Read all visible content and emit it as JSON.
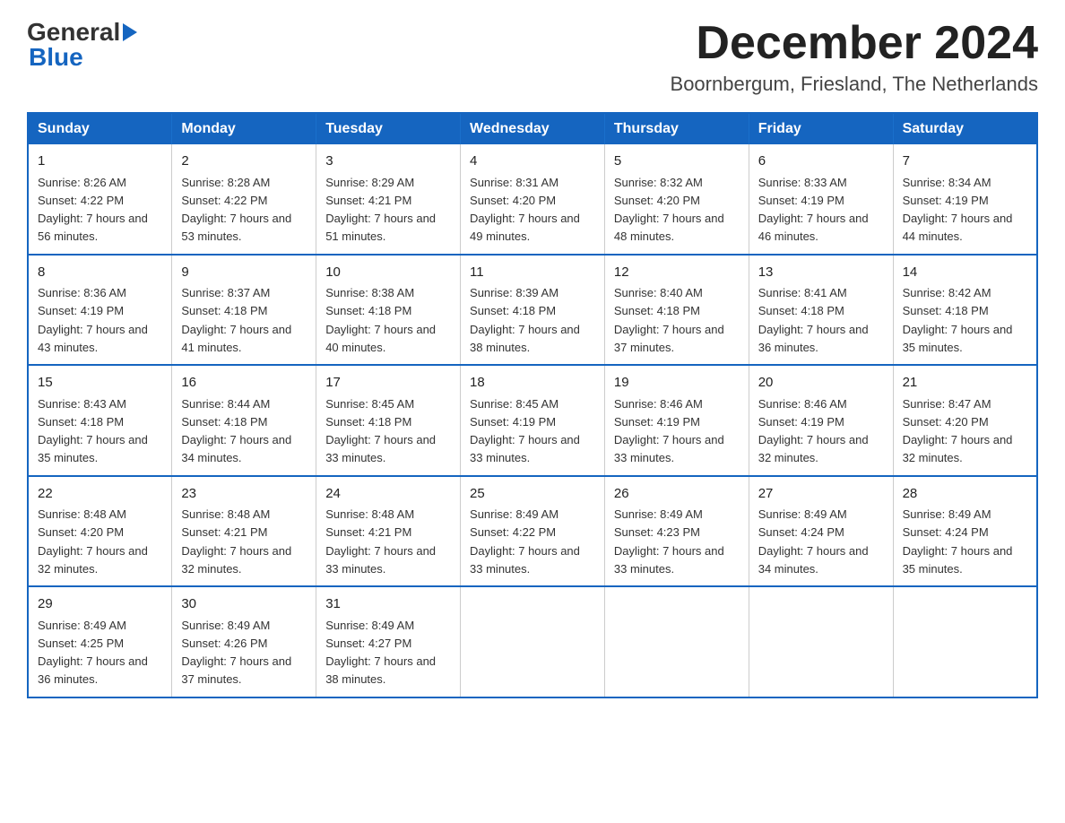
{
  "header": {
    "logo_general": "General",
    "logo_blue": "Blue",
    "month_title": "December 2024",
    "subtitle": "Boornbergum, Friesland, The Netherlands"
  },
  "weekdays": [
    "Sunday",
    "Monday",
    "Tuesday",
    "Wednesday",
    "Thursday",
    "Friday",
    "Saturday"
  ],
  "weeks": [
    [
      {
        "day": "1",
        "sunrise": "8:26 AM",
        "sunset": "4:22 PM",
        "daylight": "7 hours and 56 minutes."
      },
      {
        "day": "2",
        "sunrise": "8:28 AM",
        "sunset": "4:22 PM",
        "daylight": "7 hours and 53 minutes."
      },
      {
        "day": "3",
        "sunrise": "8:29 AM",
        "sunset": "4:21 PM",
        "daylight": "7 hours and 51 minutes."
      },
      {
        "day": "4",
        "sunrise": "8:31 AM",
        "sunset": "4:20 PM",
        "daylight": "7 hours and 49 minutes."
      },
      {
        "day": "5",
        "sunrise": "8:32 AM",
        "sunset": "4:20 PM",
        "daylight": "7 hours and 48 minutes."
      },
      {
        "day": "6",
        "sunrise": "8:33 AM",
        "sunset": "4:19 PM",
        "daylight": "7 hours and 46 minutes."
      },
      {
        "day": "7",
        "sunrise": "8:34 AM",
        "sunset": "4:19 PM",
        "daylight": "7 hours and 44 minutes."
      }
    ],
    [
      {
        "day": "8",
        "sunrise": "8:36 AM",
        "sunset": "4:19 PM",
        "daylight": "7 hours and 43 minutes."
      },
      {
        "day": "9",
        "sunrise": "8:37 AM",
        "sunset": "4:18 PM",
        "daylight": "7 hours and 41 minutes."
      },
      {
        "day": "10",
        "sunrise": "8:38 AM",
        "sunset": "4:18 PM",
        "daylight": "7 hours and 40 minutes."
      },
      {
        "day": "11",
        "sunrise": "8:39 AM",
        "sunset": "4:18 PM",
        "daylight": "7 hours and 38 minutes."
      },
      {
        "day": "12",
        "sunrise": "8:40 AM",
        "sunset": "4:18 PM",
        "daylight": "7 hours and 37 minutes."
      },
      {
        "day": "13",
        "sunrise": "8:41 AM",
        "sunset": "4:18 PM",
        "daylight": "7 hours and 36 minutes."
      },
      {
        "day": "14",
        "sunrise": "8:42 AM",
        "sunset": "4:18 PM",
        "daylight": "7 hours and 35 minutes."
      }
    ],
    [
      {
        "day": "15",
        "sunrise": "8:43 AM",
        "sunset": "4:18 PM",
        "daylight": "7 hours and 35 minutes."
      },
      {
        "day": "16",
        "sunrise": "8:44 AM",
        "sunset": "4:18 PM",
        "daylight": "7 hours and 34 minutes."
      },
      {
        "day": "17",
        "sunrise": "8:45 AM",
        "sunset": "4:18 PM",
        "daylight": "7 hours and 33 minutes."
      },
      {
        "day": "18",
        "sunrise": "8:45 AM",
        "sunset": "4:19 PM",
        "daylight": "7 hours and 33 minutes."
      },
      {
        "day": "19",
        "sunrise": "8:46 AM",
        "sunset": "4:19 PM",
        "daylight": "7 hours and 33 minutes."
      },
      {
        "day": "20",
        "sunrise": "8:46 AM",
        "sunset": "4:19 PM",
        "daylight": "7 hours and 32 minutes."
      },
      {
        "day": "21",
        "sunrise": "8:47 AM",
        "sunset": "4:20 PM",
        "daylight": "7 hours and 32 minutes."
      }
    ],
    [
      {
        "day": "22",
        "sunrise": "8:48 AM",
        "sunset": "4:20 PM",
        "daylight": "7 hours and 32 minutes."
      },
      {
        "day": "23",
        "sunrise": "8:48 AM",
        "sunset": "4:21 PM",
        "daylight": "7 hours and 32 minutes."
      },
      {
        "day": "24",
        "sunrise": "8:48 AM",
        "sunset": "4:21 PM",
        "daylight": "7 hours and 33 minutes."
      },
      {
        "day": "25",
        "sunrise": "8:49 AM",
        "sunset": "4:22 PM",
        "daylight": "7 hours and 33 minutes."
      },
      {
        "day": "26",
        "sunrise": "8:49 AM",
        "sunset": "4:23 PM",
        "daylight": "7 hours and 33 minutes."
      },
      {
        "day": "27",
        "sunrise": "8:49 AM",
        "sunset": "4:24 PM",
        "daylight": "7 hours and 34 minutes."
      },
      {
        "day": "28",
        "sunrise": "8:49 AM",
        "sunset": "4:24 PM",
        "daylight": "7 hours and 35 minutes."
      }
    ],
    [
      {
        "day": "29",
        "sunrise": "8:49 AM",
        "sunset": "4:25 PM",
        "daylight": "7 hours and 36 minutes."
      },
      {
        "day": "30",
        "sunrise": "8:49 AM",
        "sunset": "4:26 PM",
        "daylight": "7 hours and 37 minutes."
      },
      {
        "day": "31",
        "sunrise": "8:49 AM",
        "sunset": "4:27 PM",
        "daylight": "7 hours and 38 minutes."
      },
      null,
      null,
      null,
      null
    ]
  ]
}
